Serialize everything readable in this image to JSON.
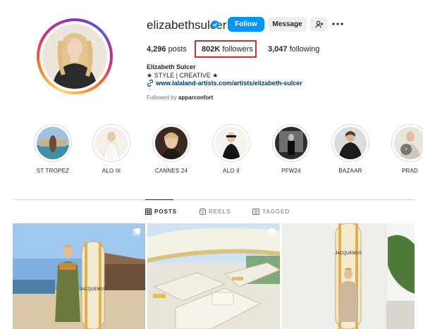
{
  "profile": {
    "username": "elizabethsulcer",
    "full_name": "Elizabeth Sulcer",
    "bio": "★ STYLE | CREATIVE ★",
    "link": "www.lalaland-artists.com/artists/elizabeth-sulcer",
    "followed_by_prefix": "Followed by",
    "followed_by_user": "apparconfort"
  },
  "actions": {
    "follow_label": "Follow",
    "message_label": "Message"
  },
  "stats": {
    "posts_count": "4,296",
    "posts_label": "posts",
    "followers_count": "802K",
    "followers_label": "followers",
    "following_count": "3,047",
    "following_label": "following"
  },
  "highlights": [
    {
      "label": "ST TROPEZ"
    },
    {
      "label": "ALO III"
    },
    {
      "label": "CANNES 24"
    },
    {
      "label": "ALO II"
    },
    {
      "label": "PFW24"
    },
    {
      "label": "BAZAAR"
    },
    {
      "label": "PRAD"
    }
  ],
  "tabs": {
    "posts": "POSTS",
    "reels": "REELS",
    "tagged": "TAGGED"
  },
  "posts": [
    {
      "board_text": "JACQUEMUS"
    },
    {
      "board_text": ""
    },
    {
      "board_text": "JACQUEMUS"
    }
  ],
  "colors": {
    "follow_button": "#0095f6",
    "highlight_box": "#d32f2f",
    "link": "#00376b",
    "verified_badge": "#0095f6"
  }
}
